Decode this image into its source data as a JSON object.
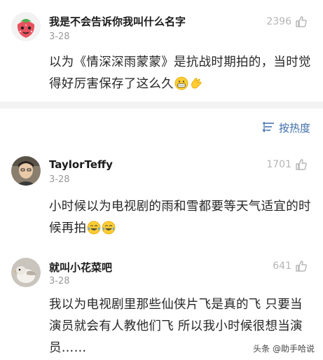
{
  "comments": [
    {
      "username": "我是不会告诉你我叫什么名字",
      "date": "3-28",
      "likes": "2396",
      "text": "以为《情深深雨蒙蒙》是抗战时期拍的，当时觉得好厉害保存了这么久",
      "avatar_icon": "strawberry-avatar-icon",
      "emojis": [
        "grin-emoji-icon",
        "clap-emoji-icon"
      ]
    },
    {
      "username": "TaylorTeffy",
      "date": "3-28",
      "likes": "1701",
      "text": "小时候以为电视剧的雨和雪都要等天气适宜的时候再拍",
      "avatar_icon": "person-photo-avatar-icon",
      "emojis": [
        "laugh-cry-emoji-icon",
        "laugh-cry-emoji-icon"
      ]
    },
    {
      "username": "就叫小花菜吧",
      "date": "3-28",
      "likes": "641",
      "text": "我以为电视剧里那些仙侠片飞是真的飞 只要当演员就会有人教他们飞 所以我小时候很想当演员……",
      "avatar_icon": "bird-photo-avatar-icon",
      "emojis": []
    }
  ],
  "sort": {
    "label": "按热度",
    "icon": "sort-icon"
  },
  "watermark": {
    "text": "头条 @助手哈说"
  },
  "colors": {
    "accent": "#3d6da8",
    "divider": "#f3f3f3",
    "muted": "#9a9a9a"
  }
}
